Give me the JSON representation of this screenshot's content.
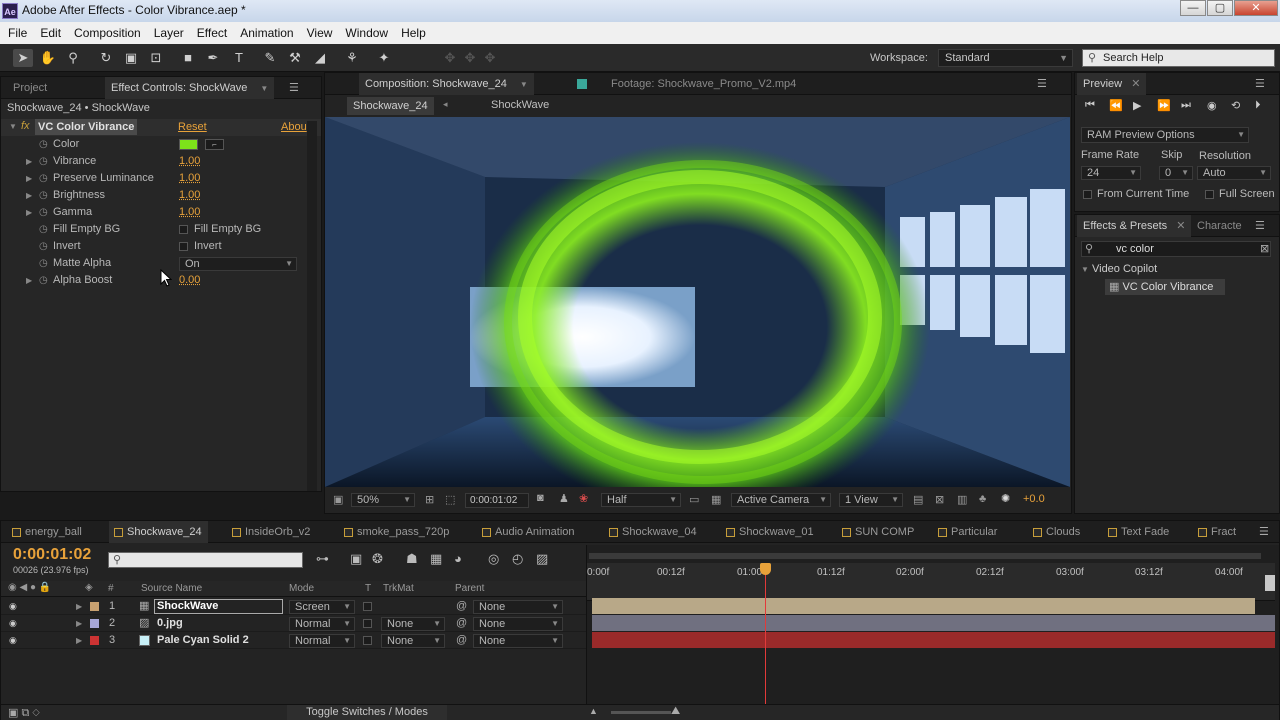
{
  "app": {
    "title": "Adobe After Effects - Color Vibrance.aep *",
    "logo": "Ae"
  },
  "menu": [
    "File",
    "Edit",
    "Composition",
    "Layer",
    "Effect",
    "Animation",
    "View",
    "Window",
    "Help"
  ],
  "toolbar": {
    "workspace_label": "Workspace:",
    "workspace_value": "Standard",
    "search_placeholder": "Search Help"
  },
  "effect_panel": {
    "tab_project": "Project",
    "tab_effect_controls": "Effect Controls: ShockWave",
    "breadcrumb": "Shockwave_24 • ShockWave",
    "effect_name": "VC Color Vibrance",
    "fx_label": "fx",
    "reset": "Reset",
    "about": "Abou",
    "properties": [
      {
        "label": "Color",
        "value": "",
        "type": "color"
      },
      {
        "label": "Vibrance",
        "value": "1.00"
      },
      {
        "label": "Preserve Luminance",
        "value": "1.00"
      },
      {
        "label": "Brightness",
        "value": "1.00"
      },
      {
        "label": "Gamma",
        "value": "1.00"
      },
      {
        "label": "Fill Empty BG",
        "value": "Fill Empty BG",
        "type": "checkbox"
      },
      {
        "label": "Invert",
        "value": "Invert",
        "type": "checkbox"
      },
      {
        "label": "Matte Alpha",
        "value": "On",
        "type": "dropdown"
      },
      {
        "label": "Alpha Boost",
        "value": "0.00"
      }
    ]
  },
  "composition": {
    "tab_label": "Composition: Shockwave_24",
    "footage_tab": "Footage: Shockwave_Promo_V2.mp4",
    "crumb1": "Shockwave_24",
    "crumb2": "ShockWave",
    "zoom": "50%",
    "timecode": "0:00:01:02",
    "resolution": "Half",
    "camera": "Active Camera",
    "view": "1 View",
    "exposure": "+0.0"
  },
  "preview": {
    "tab": "Preview",
    "ram_options": "RAM Preview Options",
    "frame_rate_label": "Frame Rate",
    "skip_label": "Skip",
    "resolution_label": "Resolution",
    "frame_rate": "24",
    "skip": "0",
    "resolution": "Auto",
    "from_current": "From Current Time",
    "full_screen": "Full Screen"
  },
  "effects_presets": {
    "tab": "Effects & Presets",
    "tab2": "Characte",
    "search_value": "vc color",
    "folder": "Video Copilot",
    "item": "VC Color Vibrance"
  },
  "timeline": {
    "tabs": [
      "energy_ball",
      "Shockwave_24",
      "InsideOrb_v2",
      "smoke_pass_720p",
      "Audio Animation",
      "Shockwave_04",
      "Shockwave_01",
      "SUN COMP",
      "Particular",
      "Clouds",
      "Text Fade",
      "Fract"
    ],
    "timecode": "0:00:01:02",
    "frames": "00026 (23.976 fps)",
    "columns": {
      "num": "#",
      "source": "Source Name",
      "mode": "Mode",
      "t": "T",
      "trkmat": "TrkMat",
      "parent": "Parent"
    },
    "ruler": [
      "0:00f",
      "00:12f",
      "01:00",
      "01:12f",
      "02:00f",
      "02:12f",
      "03:00f",
      "03:12f",
      "04:00f"
    ],
    "layers": [
      {
        "num": "1",
        "name": "ShockWave",
        "mode": "Screen",
        "trkmat": "",
        "parent": "None",
        "color": "#c7a070"
      },
      {
        "num": "2",
        "name": "0.jpg",
        "mode": "Normal",
        "trkmat": "None",
        "parent": "None",
        "color": "#a8a8d8"
      },
      {
        "num": "3",
        "name": "Pale Cyan Solid 2",
        "mode": "Normal",
        "trkmat": "None",
        "parent": "None",
        "color": "#cc3333"
      }
    ],
    "toggle_label": "Toggle Switches / Modes"
  }
}
